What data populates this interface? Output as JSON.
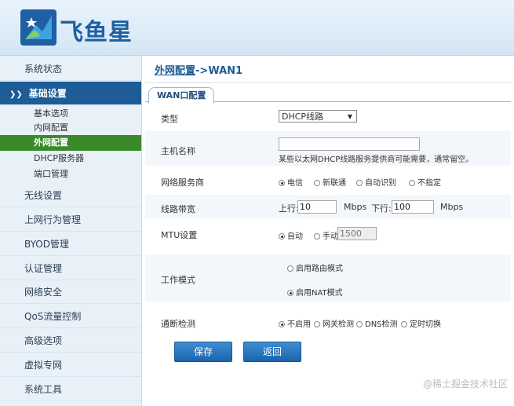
{
  "brand": {
    "name": "飞鱼星"
  },
  "sidebar": {
    "items": [
      {
        "label": "系统状态"
      },
      {
        "label": "基础设置"
      },
      {
        "label": "无线设置"
      },
      {
        "label": "上网行为管理"
      },
      {
        "label": "BYOD管理"
      },
      {
        "label": "认证管理"
      },
      {
        "label": "网络安全"
      },
      {
        "label": "QoS流量控制"
      },
      {
        "label": "高级选项"
      },
      {
        "label": "虚拟专网"
      },
      {
        "label": "系统工具"
      }
    ],
    "sub_items": [
      {
        "label": "基本选项"
      },
      {
        "label": "内网配置"
      },
      {
        "label": "外网配置"
      },
      {
        "label": "DHCP服务器"
      },
      {
        "label": "端口管理"
      }
    ]
  },
  "breadcrumb": {
    "parent": "外网配置",
    "separator": "->",
    "current": "WAN1"
  },
  "tab": {
    "label": "WAN口配置"
  },
  "form": {
    "type": {
      "label": "类型",
      "value": "DHCP线路"
    },
    "hostname": {
      "label": "主机名称",
      "value": "",
      "hint": "某些以太网DHCP线路服务提供商可能需要，通常留空。"
    },
    "isp": {
      "label": "网络服务商",
      "options": [
        "电信",
        "新联通",
        "自动识别",
        "不指定"
      ],
      "selected": "电信"
    },
    "bandwidth": {
      "label": "线路带宽",
      "up_label": "上行:",
      "up_value": "10",
      "unit1": "Mbps",
      "down_label": "下行:",
      "down_value": "100",
      "unit2": "Mbps"
    },
    "mtu": {
      "label": "MTU设置",
      "options": [
        "自动",
        "手动"
      ],
      "selected": "自动",
      "value": "1500"
    },
    "mode": {
      "label": "工作模式",
      "options": [
        "启用路由模式",
        "启用NAT模式"
      ],
      "selected": "启用NAT模式"
    },
    "detect": {
      "label": "通断检测",
      "options": [
        "不启用",
        "网关检测",
        "DNS检测",
        "定时切换"
      ],
      "selected": "不启用"
    }
  },
  "buttons": {
    "save": "保存",
    "back": "返回"
  },
  "watermark": "@稀土掘金技术社区",
  "colors": {
    "accent": "#1d5c96",
    "active_sub": "#3a8a2a",
    "button": "#2a78c2"
  }
}
